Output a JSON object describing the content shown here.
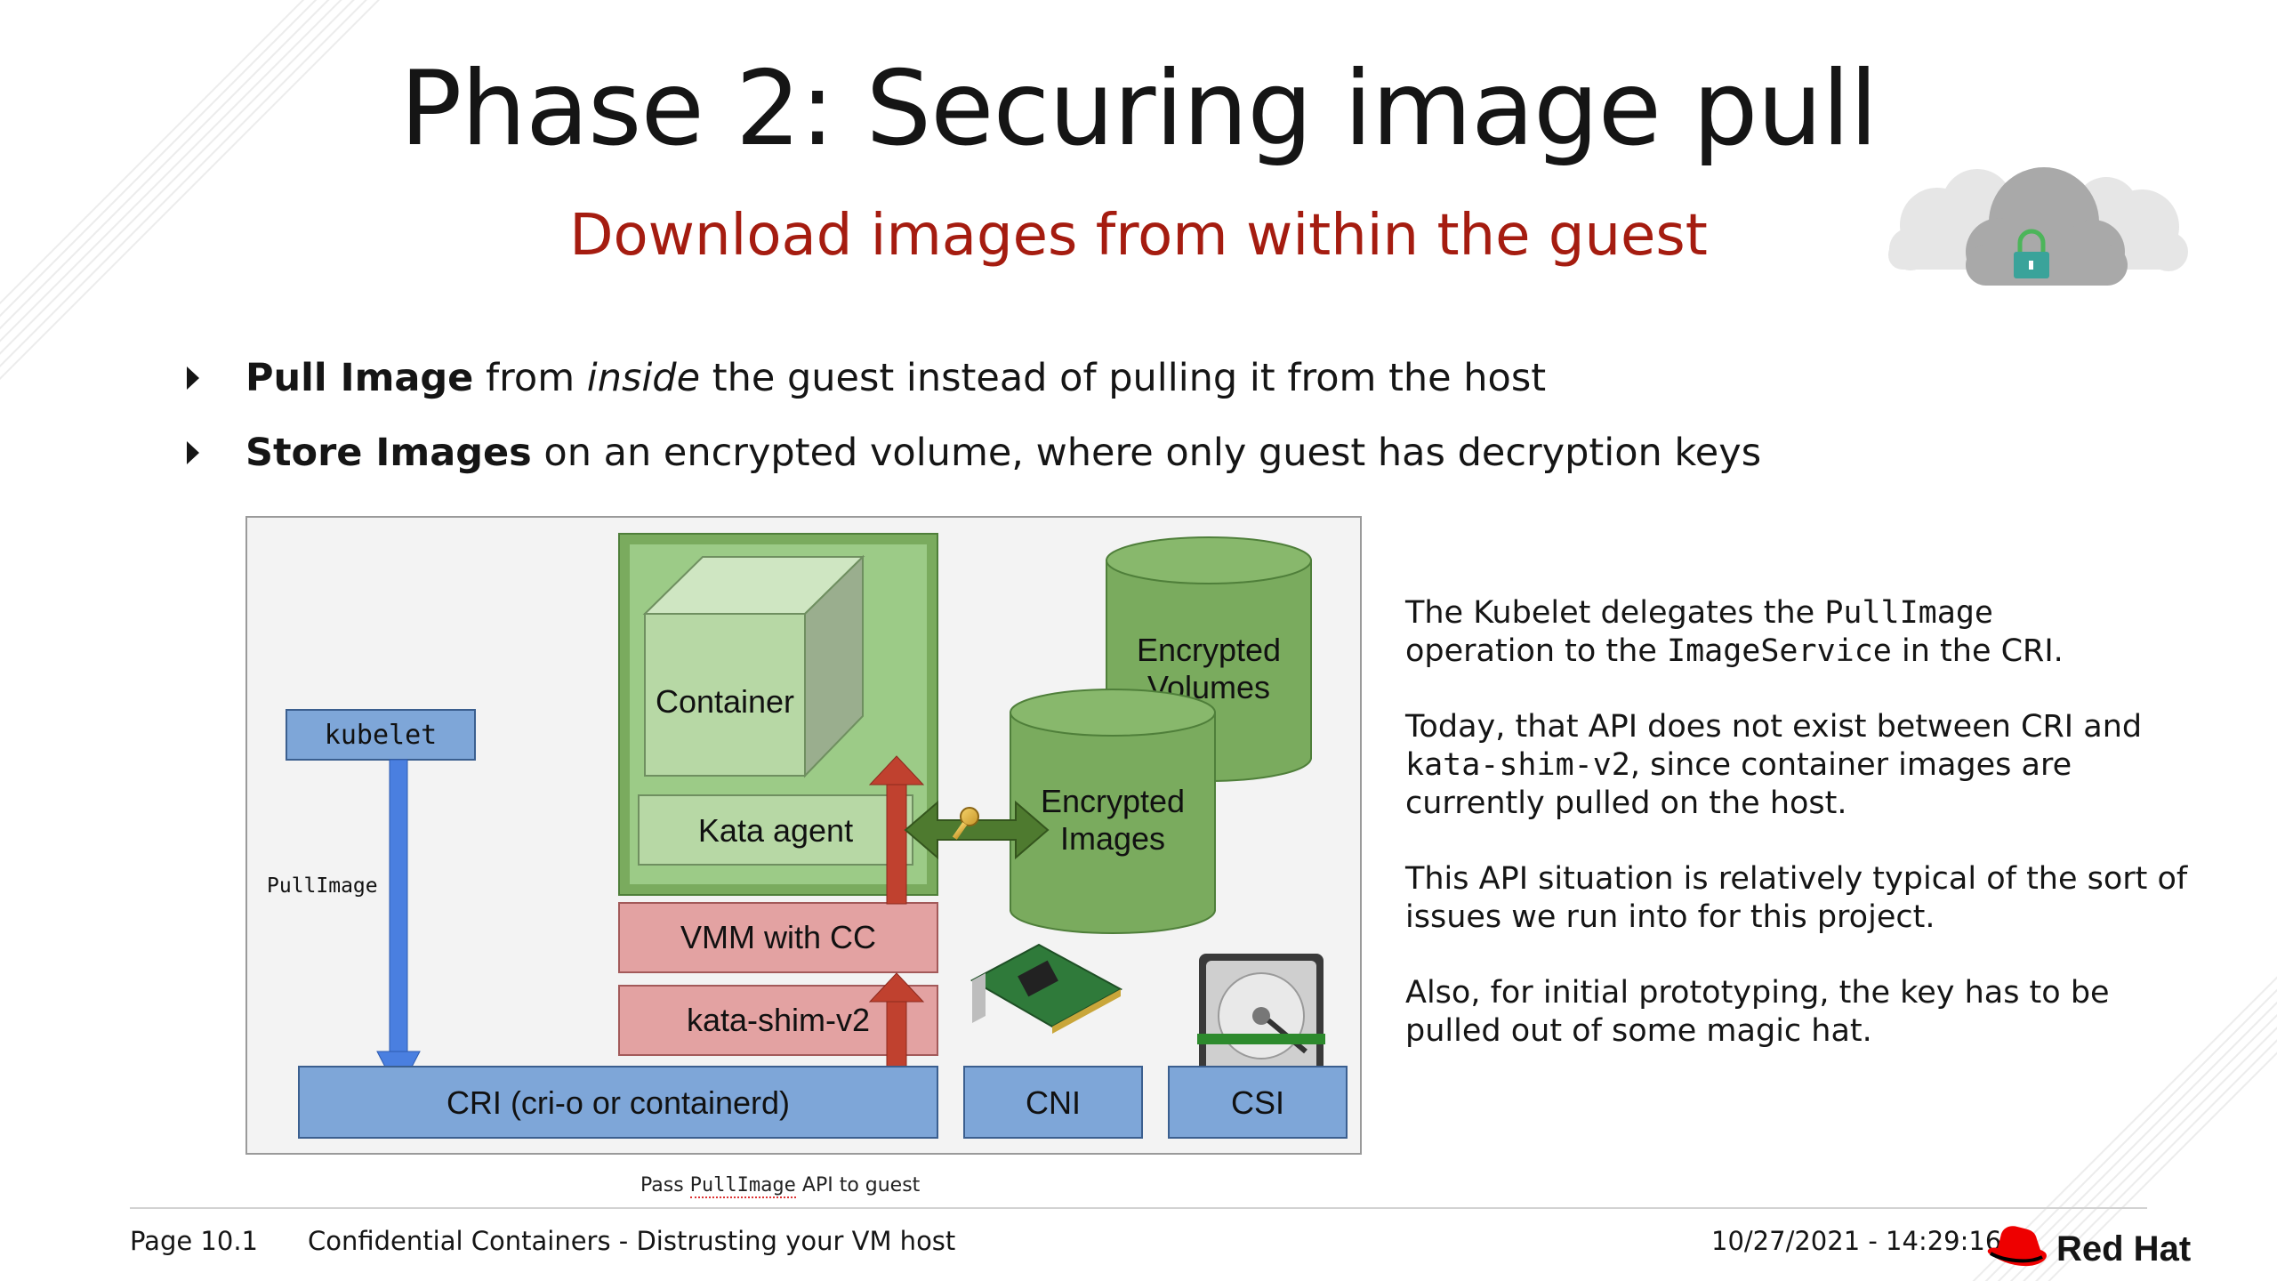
{
  "title": "Phase 2: Securing image pull",
  "subtitle": "Download images from within the guest",
  "bullets": [
    {
      "bold": "Pull Image",
      "pre": " from ",
      "italic": "inside",
      "post": " the guest instead of pulling it from the host"
    },
    {
      "bold": "Store Images",
      "pre": " on an encrypted volume, where only guest has decryption keys",
      "italic": "",
      "post": ""
    }
  ],
  "diagram": {
    "kubelet": "kubelet",
    "pull_image": "PullImage",
    "container": "Container",
    "kata_agent": "Kata agent",
    "vmm": "VMM with CC",
    "shim": "kata-shim-v2",
    "cri": "CRI (cri-o or containerd)",
    "cni": "CNI",
    "csi": "CSI",
    "encrypted_volumes_1": "Encrypted",
    "encrypted_volumes_2": "Volumes",
    "encrypted_images_1": "Encrypted",
    "encrypted_images_2": "Images"
  },
  "caption": {
    "prefix": "Pass ",
    "api": "PullImage",
    "suffix": " API to guest"
  },
  "notes": [
    {
      "a": "The Kubelet delegates the ",
      "b": "PullImage",
      "c": "operation to the ",
      "d": "ImageService",
      "e": " in the CRI."
    },
    {
      "a": "Today,  that API does not exist between CRI and ",
      "b": "kata-shim-v2",
      "c": ", since container images are currently pulled on the host."
    },
    {
      "a": "This API situation is relatively typical of the sort of issues we run into for this project."
    },
    {
      "a": "Also, for initial prototyping, the key has to be pulled out of some magic hat."
    }
  ],
  "footer": {
    "page": "Page 10.1",
    "deck": "Confidential Containers - Distrusting your VM host",
    "timestamp": "10/27/2021 - 14:29:16",
    "brand": "Red Hat"
  },
  "colors": {
    "subtitle": "#a51c10",
    "blue_box": "#7ea6d8",
    "green_dark": "#7aab5e",
    "green_light": "#b7d8a5",
    "red_box": "#e3a2a2",
    "arrow_red": "#c0412f",
    "arrow_blue": "#4a7fe0"
  }
}
